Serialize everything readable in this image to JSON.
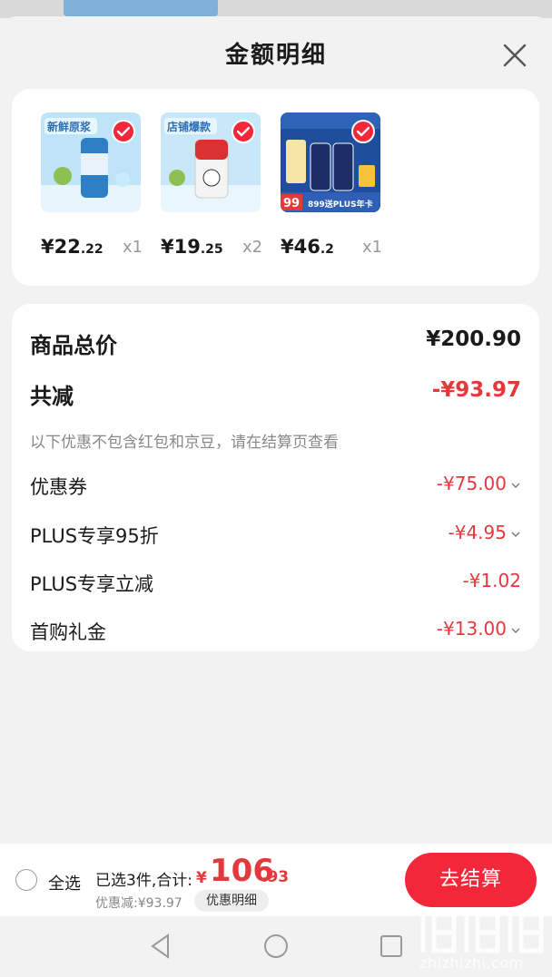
{
  "header": {
    "title": "金额明细"
  },
  "products": [
    {
      "price_int": "¥22",
      "price_dec": ".22",
      "qty": "x1",
      "badge": "新鲜原浆",
      "image_theme": "blue-can"
    },
    {
      "price_int": "¥19",
      "price_dec": ".25",
      "qty": "x2",
      "badge": "店铺爆款",
      "image_theme": "red-can"
    },
    {
      "price_int": "¥46",
      "price_dec": ".2",
      "qty": "x1",
      "badge": "899送PLUS年卡",
      "image_theme": "1664-promo"
    }
  ],
  "detail": {
    "total_label": "商品总价",
    "total_value": "¥200.90",
    "reduce_label": "共减",
    "reduce_value": "-¥93.97",
    "note": "以下优惠不包含红包和京豆，请在结算页查看",
    "items": [
      {
        "label": "优惠券",
        "value": "-¥75.00",
        "expandable": true
      },
      {
        "label": "PLUS专享95折",
        "value": "-¥4.95",
        "expandable": true
      },
      {
        "label": "PLUS专享立减",
        "value": "-¥1.02",
        "expandable": false
      },
      {
        "label": "首购礼金",
        "value": "-¥13.00",
        "expandable": true
      }
    ]
  },
  "bottom": {
    "select_all": "全选",
    "selected_text": "已选3件,合计:",
    "total_currency": "¥",
    "total_int": "106",
    "total_dec": ".93",
    "discount_text": "优惠减:¥93.97",
    "detail_pill": "优惠明细",
    "checkout_label": "去结算"
  },
  "watermark": {
    "text": "zhizhizhi.com"
  },
  "colors": {
    "accent": "#f2283a",
    "price_red": "#e4393c",
    "background": "#f2f2f2"
  }
}
